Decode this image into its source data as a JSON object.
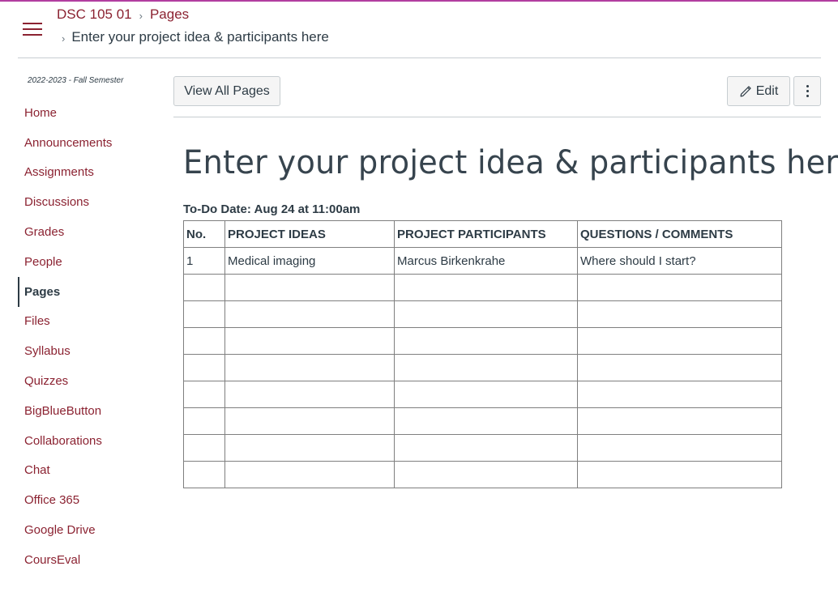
{
  "breadcrumb": {
    "course": "DSC 105 01",
    "section": "Pages",
    "current": "Enter your project idea & participants here"
  },
  "sidebar": {
    "term": "2022-2023 - Fall Semester",
    "items": [
      {
        "label": "Home"
      },
      {
        "label": "Announcements"
      },
      {
        "label": "Assignments"
      },
      {
        "label": "Discussions"
      },
      {
        "label": "Grades"
      },
      {
        "label": "People"
      },
      {
        "label": "Pages"
      },
      {
        "label": "Files"
      },
      {
        "label": "Syllabus"
      },
      {
        "label": "Quizzes"
      },
      {
        "label": "BigBlueButton"
      },
      {
        "label": "Collaborations"
      },
      {
        "label": "Chat"
      },
      {
        "label": "Office 365"
      },
      {
        "label": "Google Drive"
      },
      {
        "label": "CoursEval"
      }
    ],
    "active_item": "Pages"
  },
  "toolbar": {
    "view_all_label": "View All Pages",
    "edit_label": "Edit"
  },
  "page": {
    "title": "Enter your project idea & participants here",
    "todo_date": "To-Do Date: Aug 24 at 11:00am"
  },
  "table": {
    "headers": [
      "No.",
      "PROJECT IDEAS",
      "PROJECT PARTICIPANTS",
      "QUESTIONS / COMMENTS"
    ],
    "rows": [
      [
        "1",
        "Medical imaging",
        "Marcus Birkenkrahe",
        "Where should I start?"
      ],
      [
        "",
        "",
        "",
        ""
      ],
      [
        "",
        "",
        "",
        ""
      ],
      [
        "",
        "",
        "",
        ""
      ],
      [
        "",
        "",
        "",
        ""
      ],
      [
        "",
        "",
        "",
        ""
      ],
      [
        "",
        "",
        "",
        ""
      ],
      [
        "",
        "",
        "",
        ""
      ],
      [
        "",
        "",
        "",
        ""
      ]
    ]
  },
  "colors": {
    "brand_accent": "#b23ea0",
    "link": "#8b2231",
    "text": "#2d3b45",
    "divider": "#c7cdd1"
  }
}
